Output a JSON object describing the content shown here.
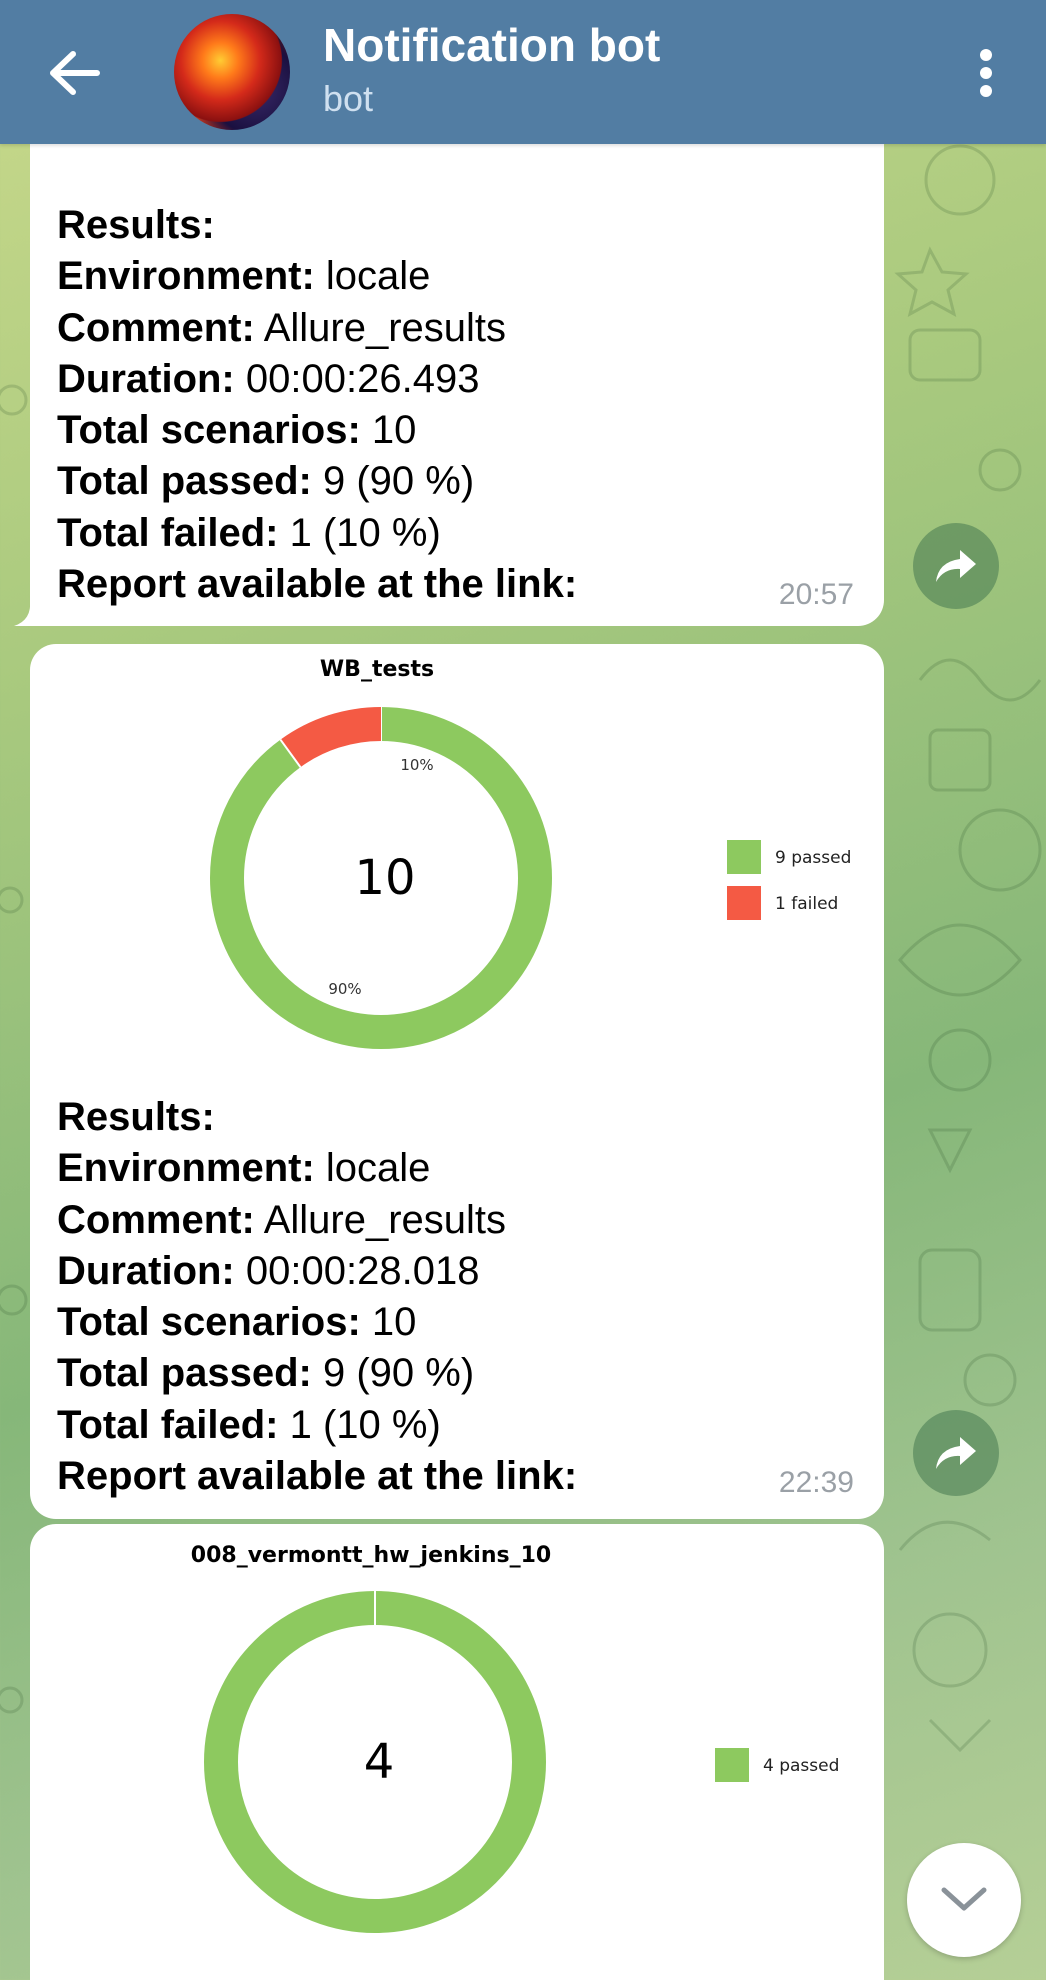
{
  "header": {
    "title": "Notification bot",
    "subtitle": "bot",
    "back_icon": "arrow-left-icon",
    "menu_icon": "more-vertical-icon"
  },
  "messages": [
    {
      "results_heading": "Results:",
      "environment_label": "Environment:",
      "environment_value": " locale",
      "comment_label": "Comment:",
      "comment_value": " Allure_results",
      "duration_label": "Duration:",
      "duration_value": " 00:00:26.493",
      "total_scenarios_label": "Total scenarios:",
      "total_scenarios_value": " 10",
      "total_passed_label": "Total passed:",
      "total_passed_value": " 9 (90 %)",
      "total_failed_label": "Total failed:",
      "total_failed_value": " 1 (10 %)",
      "report_label": "Report available at the link:",
      "time": "20:57"
    },
    {
      "results_heading": "Results:",
      "environment_label": "Environment:",
      "environment_value": " locale",
      "comment_label": "Comment:",
      "comment_value": " Allure_results",
      "duration_label": "Duration:",
      "duration_value": " 00:00:28.018",
      "total_scenarios_label": "Total scenarios:",
      "total_scenarios_value": " 10",
      "total_passed_label": "Total passed:",
      "total_passed_value": " 9 (90 %)",
      "total_failed_label": "Total failed:",
      "total_failed_value": " 1 (10 %)",
      "report_label": "Report available at the link:",
      "time": "22:39"
    }
  ],
  "colors": {
    "passed": "#8dc95f",
    "failed": "#f45a44",
    "header": "#527da3"
  },
  "chart_data": [
    {
      "type": "pie",
      "title": "WB_tests",
      "center_label": "10",
      "categories": [
        "9 passed",
        "1 failed"
      ],
      "values": [
        9,
        1
      ],
      "slice_labels": [
        "90%",
        "10%"
      ],
      "colors": [
        "#8dc95f",
        "#f45a44"
      ],
      "legend": "right"
    },
    {
      "type": "pie",
      "title": "008_vermontt_hw_jenkins_10",
      "center_label": "4",
      "categories": [
        "4 passed"
      ],
      "values": [
        4
      ],
      "slice_labels": [],
      "colors": [
        "#8dc95f"
      ],
      "legend": "right"
    }
  ],
  "controls": {
    "share_icon": "share-arrow-icon",
    "scroll_down_icon": "chevron-down-icon"
  }
}
